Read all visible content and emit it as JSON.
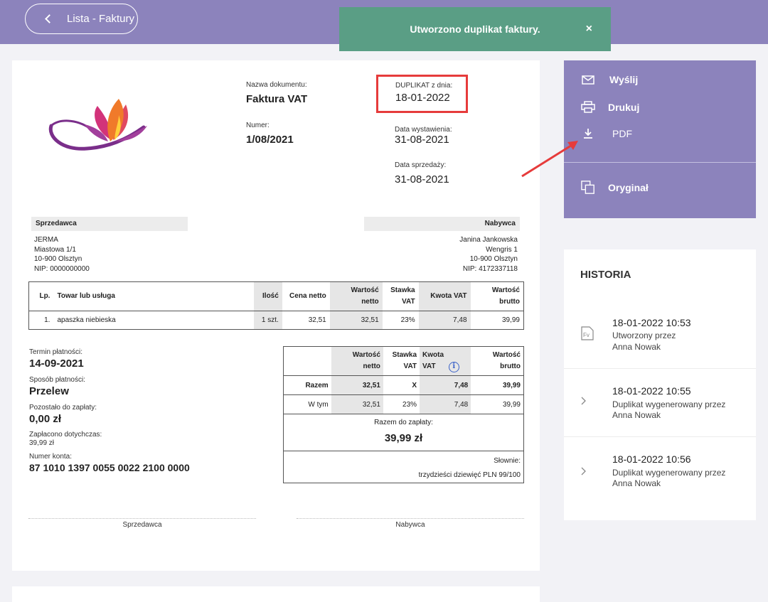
{
  "nav": {
    "back_label": "Lista - Faktury"
  },
  "toast": {
    "message": "Utworzono duplikat faktury.",
    "close": "×"
  },
  "invoice": {
    "doc_name_label": "Nazwa dokumentu:",
    "doc_name": "Faktura VAT",
    "number_label": "Numer:",
    "number": "1/08/2021",
    "duplicate_label": "DUPLIKAT z dnia:",
    "duplicate_date": "18-01-2022",
    "issue_label": "Data wystawienia:",
    "issue_date": "31-08-2021",
    "sale_label": "Data sprzedaży:",
    "sale_date": "31-08-2021",
    "seller": {
      "heading": "Sprzedawca",
      "lines": [
        "JERMA",
        "Miastowa 1/1",
        "10-900 Olsztyn",
        "NIP: 0000000000"
      ]
    },
    "buyer": {
      "heading": "Nabywca",
      "lines": [
        "Janina Jankowska",
        "Wengris 1",
        "10-900 Olsztyn",
        "NIP: 4172337118"
      ]
    },
    "items_headers": [
      "Lp.",
      "Towar lub usługa",
      "Ilość",
      "Cena netto",
      "Wartość netto",
      "Stawka VAT",
      "Kwota VAT",
      "Wartość brutto"
    ],
    "items": [
      [
        "1.",
        "apaszka niebieska",
        "1 szt.",
        "32,51",
        "32,51",
        "23%",
        "7,48",
        "39,99"
      ]
    ],
    "payment": {
      "due_label": "Termin płatności:",
      "due": "14-09-2021",
      "method_label": "Sposób płatności:",
      "method": "Przelew",
      "remaining_label": "Pozostało do zapłaty:",
      "remaining": "0,00 zł",
      "paid_label": "Zapłacono dotychczas:",
      "paid": "39,99 zł",
      "account_label": "Numer konta:",
      "account": "87 1010 1397 0055 0022 2100 0000"
    },
    "summary": {
      "headers": [
        "Wartość netto",
        "Stawka VAT",
        "Kwota VAT",
        "Wartość brutto"
      ],
      "total_row": [
        "Razem",
        "32,51",
        "X",
        "7,48",
        "39,99"
      ],
      "detail_row": [
        "W tym",
        "32,51",
        "23%",
        "7,48",
        "39,99"
      ],
      "to_pay_label": "Razem do zapłaty:",
      "to_pay": "39,99 zł",
      "words_label": "Słownie:",
      "words": "trzydzieści dziewięć PLN 99/100"
    },
    "signatures": {
      "seller": "Sprzedawca",
      "buyer": "Nabywca"
    }
  },
  "actions": {
    "send": "Wyślij",
    "print": "Drukuj",
    "pdf": "PDF",
    "original": "Oryginał"
  },
  "history": {
    "title": "HISTORIA",
    "items": [
      {
        "datetime": "18-01-2022 10:53",
        "line1": "Utworzony przez",
        "line2": "Anna Nowak",
        "icon": "fv-document-icon"
      },
      {
        "datetime": "18-01-2022 10:55",
        "line1": "Duplikat wygenerowany przez",
        "line2": "Anna Nowak",
        "icon": "chevron-right-icon"
      },
      {
        "datetime": "18-01-2022 10:56",
        "line1": "Duplikat wygenerowany przez",
        "line2": "Anna Nowak",
        "icon": "chevron-right-icon"
      }
    ]
  },
  "colors": {
    "header": "#8c83bc",
    "toast": "#5a9e85",
    "highlight": "#e63b3b"
  }
}
